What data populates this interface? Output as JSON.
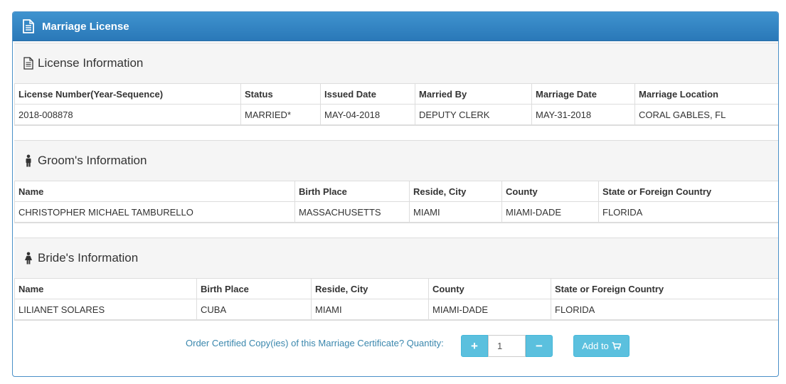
{
  "panel": {
    "title": "Marriage License"
  },
  "license": {
    "title": "License Information",
    "headers": [
      "License Number(Year-Sequence)",
      "Status",
      "Issued Date",
      "Married By",
      "Marriage Date",
      "Marriage Location"
    ],
    "row": [
      "2018-008878",
      "MARRIED*",
      "MAY-04-2018",
      "DEPUTY CLERK",
      "MAY-31-2018",
      "CORAL GABLES, FL"
    ]
  },
  "groom": {
    "title": "Groom's Information",
    "headers": [
      "Name",
      "Birth Place",
      "Reside, City",
      "County",
      "State or Foreign Country"
    ],
    "row": [
      "CHRISTOPHER MICHAEL TAMBURELLO",
      "MASSACHUSETTS",
      "MIAMI",
      "MIAMI-DADE",
      "FLORIDA"
    ]
  },
  "bride": {
    "title": "Bride's Information",
    "headers": [
      "Name",
      "Birth Place",
      "Reside, City",
      "County",
      "State or Foreign Country"
    ],
    "row": [
      "LILIANET SOLARES",
      "CUBA",
      "MIAMI",
      "MIAMI-DADE",
      "FLORIDA"
    ]
  },
  "order": {
    "text": "Order Certified Copy(ies) of this Marriage Certificate?  Quantity:",
    "plus": "+",
    "quantity": "1",
    "minus": "−",
    "add_label": "Add to"
  },
  "icons": {
    "panel": "document-icon",
    "license": "file-text-icon",
    "groom": "male-icon",
    "bride": "female-icon",
    "cart": "cart-icon"
  },
  "colors": {
    "header": "#2a78b8",
    "button": "#5bc0de",
    "link_text": "#3a87ad"
  }
}
